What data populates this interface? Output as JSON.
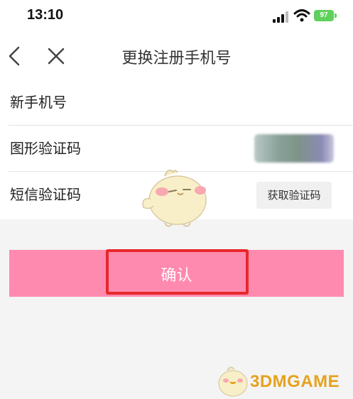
{
  "status_bar": {
    "time": "13:10",
    "battery": "97"
  },
  "nav": {
    "title": "更换注册手机号"
  },
  "form": {
    "phone_label": "新手机号",
    "captcha_label": "图形验证码",
    "sms_label": "短信验证码",
    "get_code_label": "获取验证码"
  },
  "confirm_label": "确认",
  "watermark": "3DMGAME",
  "colors": {
    "accent": "#ff8ab0",
    "highlight": "#e8282a",
    "battery": "#5fd05c"
  }
}
